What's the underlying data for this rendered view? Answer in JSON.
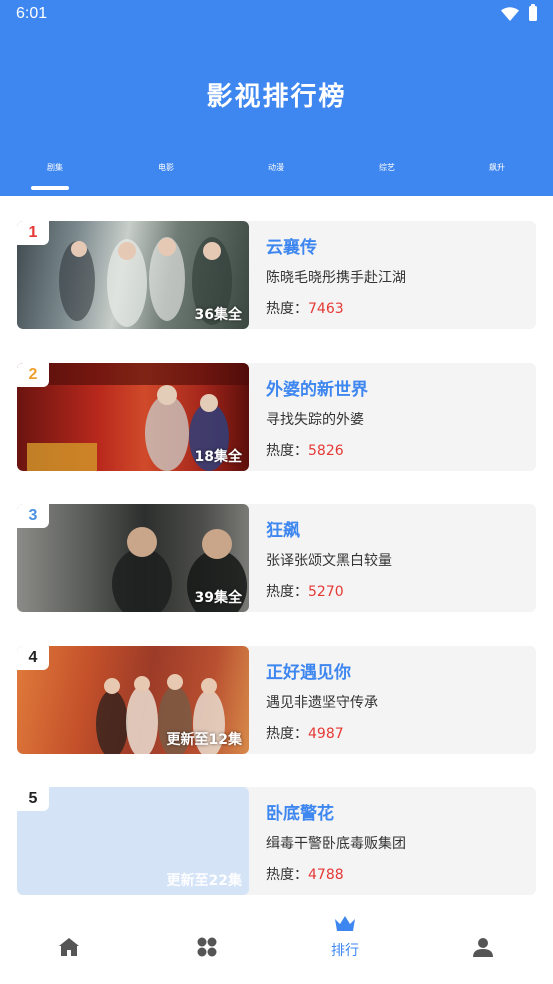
{
  "status_bar": {
    "time": "6:01"
  },
  "header": {
    "title": "影视排行榜"
  },
  "colors": {
    "primary": "#3f87f0",
    "heat": "#e53935",
    "rank1": "#e53935",
    "rank2": "#f0a030",
    "rank3": "#4a90e2",
    "rank_default": "#222222"
  },
  "tabs": [
    {
      "label": "剧集",
      "active": true
    },
    {
      "label": "电影",
      "active": false
    },
    {
      "label": "动漫",
      "active": false
    },
    {
      "label": "综艺",
      "active": false
    },
    {
      "label": "飙升",
      "active": false
    }
  ],
  "heat_label": "热度：",
  "items": [
    {
      "rank": "1",
      "title": "云襄传",
      "desc": "陈晓毛晓彤携手赴江湖",
      "heat": "7463",
      "episodes": "36集全"
    },
    {
      "rank": "2",
      "title": "外婆的新世界",
      "desc": "寻找失踪的外婆",
      "heat": "5826",
      "episodes": "18集全"
    },
    {
      "rank": "3",
      "title": "狂飙",
      "desc": "张译张颂文黑白较量",
      "heat": "5270",
      "episodes": "39集全"
    },
    {
      "rank": "4",
      "title": "正好遇见你",
      "desc": "遇见非遗坚守传承",
      "heat": "4987",
      "episodes": "更新至12集"
    },
    {
      "rank": "5",
      "title": "卧底警花",
      "desc": "缉毒干警卧底毒贩集团",
      "heat": "4788",
      "episodes": "更新至22集"
    }
  ],
  "bottom_nav": [
    {
      "icon": "home-icon",
      "label": "",
      "active": false
    },
    {
      "icon": "category-icon",
      "label": "",
      "active": false
    },
    {
      "icon": "crown-icon",
      "label": "排行",
      "active": true
    },
    {
      "icon": "user-icon",
      "label": "",
      "active": false
    }
  ]
}
